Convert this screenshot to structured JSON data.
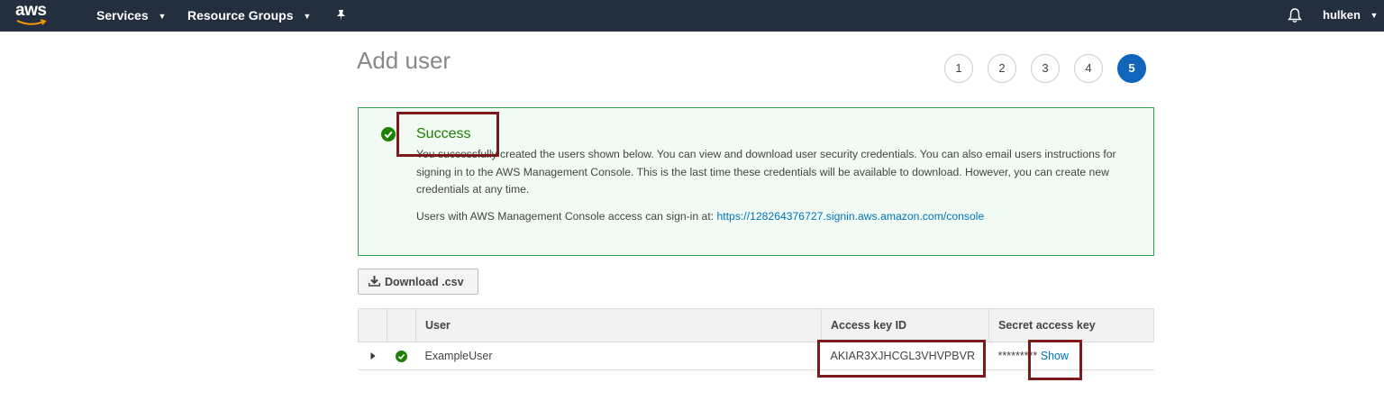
{
  "nav": {
    "logo_text": "aws",
    "services_label": "Services",
    "resource_groups_label": "Resource Groups",
    "user_label": "hulken"
  },
  "page": {
    "title": "Add user"
  },
  "steps": [
    "1",
    "2",
    "3",
    "4",
    "5"
  ],
  "active_step": "5",
  "success": {
    "title": "Success",
    "description": "You successfully created the users shown below. You can view and download user security credentials. You can also email users instructions for signing in to the AWS Management Console. This is the last time these credentials will be available to download. However, you can create new credentials at any time.",
    "signin_text": "Users with AWS Management Console access can sign-in at:",
    "signin_url": "https://128264376727.signin.aws.amazon.com/console"
  },
  "download_button_label": "Download .csv",
  "table": {
    "headers": {
      "user": "User",
      "access_key_id": "Access key ID",
      "secret_access_key": "Secret access key"
    },
    "rows": [
      {
        "user": "ExampleUser",
        "access_key_id": "AKIAR3XJHCGL3VHVPBVR",
        "secret_masked": "*********",
        "show_label": "Show"
      }
    ]
  },
  "colors": {
    "nav_bg": "#232f3e",
    "success_border": "#2ea44f",
    "success_bg": "#f2fbf3",
    "success_green": "#1d8102",
    "link_blue": "#0073bb",
    "active_step": "#1166bb",
    "annotation": "#7a1a1a"
  }
}
